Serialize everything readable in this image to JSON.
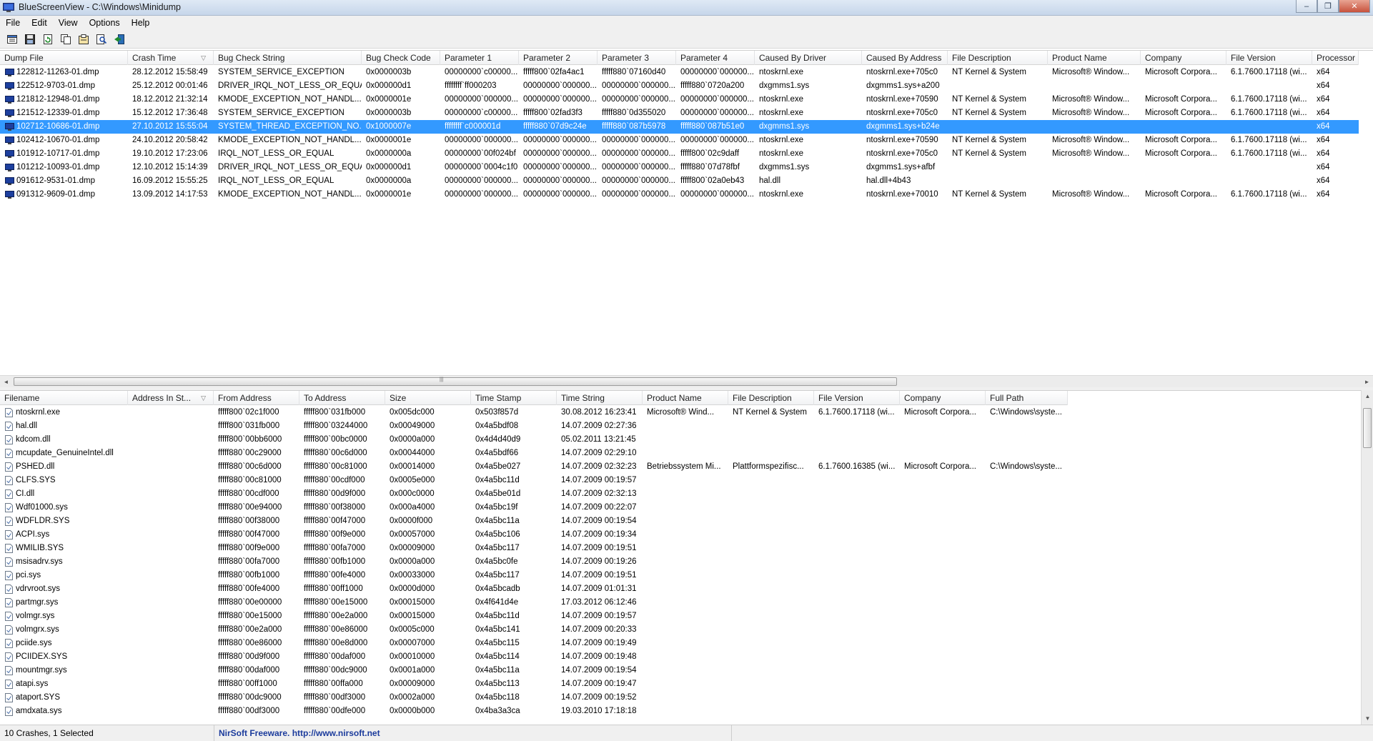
{
  "window": {
    "title": "BlueScreenView  -  C:\\Windows\\Minidump",
    "minimize": "–",
    "restore": "❐",
    "close": "✕"
  },
  "menu": [
    {
      "label": "File"
    },
    {
      "label": "Edit"
    },
    {
      "label": "View"
    },
    {
      "label": "Options"
    },
    {
      "label": "Help"
    }
  ],
  "toolbar_icons": [
    "properties-icon",
    "save-icon",
    "refresh-icon",
    "copy-icon",
    "html-report-icon",
    "find-icon",
    "exit-icon"
  ],
  "crash_table": {
    "sort_column": "Crash Time",
    "columns": [
      "Dump File",
      "Crash Time",
      "Bug Check String",
      "Bug Check Code",
      "Parameter 1",
      "Parameter 2",
      "Parameter 3",
      "Parameter 4",
      "Caused By Driver",
      "Caused By Address",
      "File Description",
      "Product Name",
      "Company",
      "File Version",
      "Processor"
    ],
    "rows": [
      [
        "122812-11263-01.dmp",
        "28.12.2012 15:58:49",
        "SYSTEM_SERVICE_EXCEPTION",
        "0x0000003b",
        "00000000`c00000...",
        "fffff800`02fa4ac1",
        "fffff880`07160d40",
        "00000000`000000...",
        "ntoskrnl.exe",
        "ntoskrnl.exe+705c0",
        "NT Kernel & System",
        "Microsoft® Window...",
        "Microsoft Corpora...",
        "6.1.7600.17118 (wi...",
        "x64"
      ],
      [
        "122512-9703-01.dmp",
        "25.12.2012 00:01:46",
        "DRIVER_IRQL_NOT_LESS_OR_EQUAL",
        "0x000000d1",
        "ffffffff`ff000203",
        "00000000`000000...",
        "00000000`000000...",
        "fffff880`0720a200",
        "dxgmms1.sys",
        "dxgmms1.sys+a200",
        "",
        "",
        "",
        "",
        "x64"
      ],
      [
        "121812-12948-01.dmp",
        "18.12.2012 21:32:14",
        "KMODE_EXCEPTION_NOT_HANDL...",
        "0x0000001e",
        "00000000`000000...",
        "00000000`000000...",
        "00000000`000000...",
        "00000000`000000...",
        "ntoskrnl.exe",
        "ntoskrnl.exe+70590",
        "NT Kernel & System",
        "Microsoft® Window...",
        "Microsoft Corpora...",
        "6.1.7600.17118 (wi...",
        "x64"
      ],
      [
        "121512-12339-01.dmp",
        "15.12.2012 17:36:48",
        "SYSTEM_SERVICE_EXCEPTION",
        "0x0000003b",
        "00000000`c00000...",
        "fffff800`02fad3f3",
        "fffff880`0d355020",
        "00000000`000000...",
        "ntoskrnl.exe",
        "ntoskrnl.exe+705c0",
        "NT Kernel & System",
        "Microsoft® Window...",
        "Microsoft Corpora...",
        "6.1.7600.17118 (wi...",
        "x64"
      ],
      [
        "102712-10686-01.dmp",
        "27.10.2012 15:55:04",
        "SYSTEM_THREAD_EXCEPTION_NO...",
        "0x1000007e",
        "ffffffff`c000001d",
        "fffff880`07d9c24e",
        "fffff880`087b5978",
        "fffff880`087b51e0",
        "dxgmms1.sys",
        "dxgmms1.sys+b24e",
        "",
        "",
        "",
        "",
        "x64"
      ],
      [
        "102412-10670-01.dmp",
        "24.10.2012 20:58:42",
        "KMODE_EXCEPTION_NOT_HANDL...",
        "0x0000001e",
        "00000000`000000...",
        "00000000`000000...",
        "00000000`000000...",
        "00000000`000000...",
        "ntoskrnl.exe",
        "ntoskrnl.exe+70590",
        "NT Kernel & System",
        "Microsoft® Window...",
        "Microsoft Corpora...",
        "6.1.7600.17118 (wi...",
        "x64"
      ],
      [
        "101912-10717-01.dmp",
        "19.10.2012 17:23:06",
        "IRQL_NOT_LESS_OR_EQUAL",
        "0x0000000a",
        "00000000`00f024bf",
        "00000000`000000...",
        "00000000`000000...",
        "fffff800`02c9daff",
        "ntoskrnl.exe",
        "ntoskrnl.exe+705c0",
        "NT Kernel & System",
        "Microsoft® Window...",
        "Microsoft Corpora...",
        "6.1.7600.17118 (wi...",
        "x64"
      ],
      [
        "101212-10093-01.dmp",
        "12.10.2012 15:14:39",
        "DRIVER_IRQL_NOT_LESS_OR_EQUAL",
        "0x000000d1",
        "00000000`0004c1f0",
        "00000000`000000...",
        "00000000`000000...",
        "fffff880`07d78fbf",
        "dxgmms1.sys",
        "dxgmms1.sys+afbf",
        "",
        "",
        "",
        "",
        "x64"
      ],
      [
        "091612-9531-01.dmp",
        "16.09.2012 15:55:25",
        "IRQL_NOT_LESS_OR_EQUAL",
        "0x0000000a",
        "00000000`000000...",
        "00000000`000000...",
        "00000000`000000...",
        "fffff800`02a0eb43",
        "hal.dll",
        "hal.dll+4b43",
        "",
        "",
        "",
        "",
        "x64"
      ],
      [
        "091312-9609-01.dmp",
        "13.09.2012 14:17:53",
        "KMODE_EXCEPTION_NOT_HANDL...",
        "0x0000001e",
        "00000000`000000...",
        "00000000`000000...",
        "00000000`000000...",
        "00000000`000000...",
        "ntoskrnl.exe",
        "ntoskrnl.exe+70010",
        "NT Kernel & System",
        "Microsoft® Window...",
        "Microsoft Corpora...",
        "6.1.7600.17118 (wi...",
        "x64"
      ]
    ],
    "selected_index": 4
  },
  "driver_table": {
    "sort_column": "Address In St...",
    "columns": [
      "Filename",
      "Address In St...",
      "From Address",
      "To Address",
      "Size",
      "Time Stamp",
      "Time String",
      "Product Name",
      "File Description",
      "File Version",
      "Company",
      "Full Path"
    ],
    "rows": [
      [
        "ntoskrnl.exe",
        "",
        "fffff800`02c1f000",
        "fffff800`031fb000",
        "0x005dc000",
        "0x503f857d",
        "30.08.2012 16:23:41",
        "Microsoft® Wind...",
        "NT Kernel & System",
        "6.1.7600.17118 (wi...",
        "Microsoft Corpora...",
        "C:\\Windows\\syste..."
      ],
      [
        "hal.dll",
        "",
        "fffff800`031fb000",
        "fffff800`03244000",
        "0x00049000",
        "0x4a5bdf08",
        "14.07.2009 02:27:36",
        "",
        "",
        "",
        "",
        ""
      ],
      [
        "kdcom.dll",
        "",
        "fffff800`00bb6000",
        "fffff800`00bc0000",
        "0x0000a000",
        "0x4d4d40d9",
        "05.02.2011 13:21:45",
        "",
        "",
        "",
        "",
        ""
      ],
      [
        "mcupdate_GenuineIntel.dll",
        "",
        "fffff880`00c29000",
        "fffff880`00c6d000",
        "0x00044000",
        "0x4a5bdf66",
        "14.07.2009 02:29:10",
        "",
        "",
        "",
        "",
        ""
      ],
      [
        "PSHED.dll",
        "",
        "fffff880`00c6d000",
        "fffff880`00c81000",
        "0x00014000",
        "0x4a5be027",
        "14.07.2009 02:32:23",
        "Betriebssystem Mi...",
        "Plattformspezifisc...",
        "6.1.7600.16385 (wi...",
        "Microsoft Corpora...",
        "C:\\Windows\\syste..."
      ],
      [
        "CLFS.SYS",
        "",
        "fffff880`00c81000",
        "fffff880`00cdf000",
        "0x0005e000",
        "0x4a5bc11d",
        "14.07.2009 00:19:57",
        "",
        "",
        "",
        "",
        ""
      ],
      [
        "CI.dll",
        "",
        "fffff880`00cdf000",
        "fffff880`00d9f000",
        "0x000c0000",
        "0x4a5be01d",
        "14.07.2009 02:32:13",
        "",
        "",
        "",
        "",
        ""
      ],
      [
        "Wdf01000.sys",
        "",
        "fffff880`00e94000",
        "fffff880`00f38000",
        "0x000a4000",
        "0x4a5bc19f",
        "14.07.2009 00:22:07",
        "",
        "",
        "",
        "",
        ""
      ],
      [
        "WDFLDR.SYS",
        "",
        "fffff880`00f38000",
        "fffff880`00f47000",
        "0x0000f000",
        "0x4a5bc11a",
        "14.07.2009 00:19:54",
        "",
        "",
        "",
        "",
        ""
      ],
      [
        "ACPI.sys",
        "",
        "fffff880`00f47000",
        "fffff880`00f9e000",
        "0x00057000",
        "0x4a5bc106",
        "14.07.2009 00:19:34",
        "",
        "",
        "",
        "",
        ""
      ],
      [
        "WMILIB.SYS",
        "",
        "fffff880`00f9e000",
        "fffff880`00fa7000",
        "0x00009000",
        "0x4a5bc117",
        "14.07.2009 00:19:51",
        "",
        "",
        "",
        "",
        ""
      ],
      [
        "msisadrv.sys",
        "",
        "fffff880`00fa7000",
        "fffff880`00fb1000",
        "0x0000a000",
        "0x4a5bc0fe",
        "14.07.2009 00:19:26",
        "",
        "",
        "",
        "",
        ""
      ],
      [
        "pci.sys",
        "",
        "fffff880`00fb1000",
        "fffff880`00fe4000",
        "0x00033000",
        "0x4a5bc117",
        "14.07.2009 00:19:51",
        "",
        "",
        "",
        "",
        ""
      ],
      [
        "vdrvroot.sys",
        "",
        "fffff880`00fe4000",
        "fffff880`00ff1000",
        "0x0000d000",
        "0x4a5bcadb",
        "14.07.2009 01:01:31",
        "",
        "",
        "",
        "",
        ""
      ],
      [
        "partmgr.sys",
        "",
        "fffff880`00e00000",
        "fffff880`00e15000",
        "0x00015000",
        "0x4f641d4e",
        "17.03.2012 06:12:46",
        "",
        "",
        "",
        "",
        ""
      ],
      [
        "volmgr.sys",
        "",
        "fffff880`00e15000",
        "fffff880`00e2a000",
        "0x00015000",
        "0x4a5bc11d",
        "14.07.2009 00:19:57",
        "",
        "",
        "",
        "",
        ""
      ],
      [
        "volmgrx.sys",
        "",
        "fffff880`00e2a000",
        "fffff880`00e86000",
        "0x0005c000",
        "0x4a5bc141",
        "14.07.2009 00:20:33",
        "",
        "",
        "",
        "",
        ""
      ],
      [
        "pciide.sys",
        "",
        "fffff880`00e86000",
        "fffff880`00e8d000",
        "0x00007000",
        "0x4a5bc115",
        "14.07.2009 00:19:49",
        "",
        "",
        "",
        "",
        ""
      ],
      [
        "PCIIDEX.SYS",
        "",
        "fffff880`00d9f000",
        "fffff880`00daf000",
        "0x00010000",
        "0x4a5bc114",
        "14.07.2009 00:19:48",
        "",
        "",
        "",
        "",
        ""
      ],
      [
        "mountmgr.sys",
        "",
        "fffff880`00daf000",
        "fffff880`00dc9000",
        "0x0001a000",
        "0x4a5bc11a",
        "14.07.2009 00:19:54",
        "",
        "",
        "",
        "",
        ""
      ],
      [
        "atapi.sys",
        "",
        "fffff880`00ff1000",
        "fffff880`00ffa000",
        "0x00009000",
        "0x4a5bc113",
        "14.07.2009 00:19:47",
        "",
        "",
        "",
        "",
        ""
      ],
      [
        "ataport.SYS",
        "",
        "fffff880`00dc9000",
        "fffff880`00df3000",
        "0x0002a000",
        "0x4a5bc118",
        "14.07.2009 00:19:52",
        "",
        "",
        "",
        "",
        ""
      ],
      [
        "amdxata.sys",
        "",
        "fffff880`00df3000",
        "fffff880`00dfe000",
        "0x0000b000",
        "0x4ba3a3ca",
        "19.03.2010 17:18:18",
        "",
        "",
        "",
        "",
        ""
      ]
    ]
  },
  "status": {
    "count": "10 Crashes, 1 Selected",
    "credit": "NirSoft Freeware.  http://www.nirsoft.net"
  }
}
